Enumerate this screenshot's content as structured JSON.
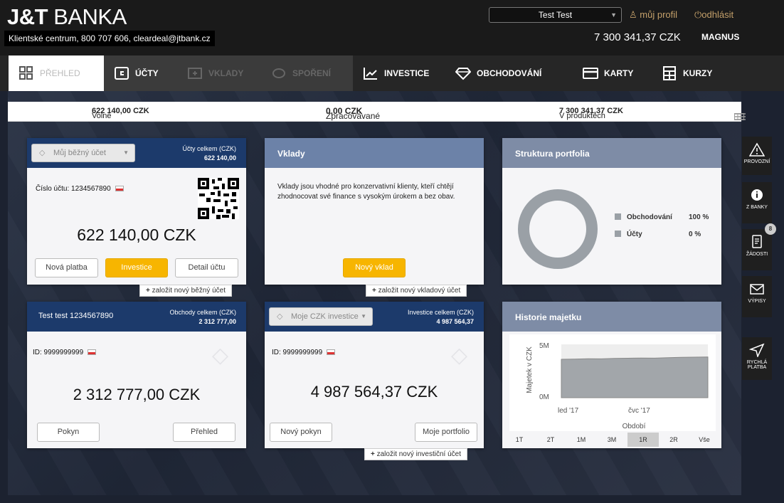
{
  "header": {
    "logo_bold": "J&T",
    "logo_rest": " BANKA",
    "contact": "Klientské centrum, 800 707 606, cleardeal@jtbank.cz",
    "profile_name": "Test Test",
    "my_profile": "můj profil",
    "logout": "odhlásit",
    "total_balance": "7 300 341,37 CZK",
    "segment": "MAGNUS"
  },
  "nav": {
    "items": [
      {
        "label": "PŘEHLED",
        "icon": "grid-icon"
      },
      {
        "label": "ÚČTY",
        "icon": "wallet-icon"
      },
      {
        "label": "VKLADY",
        "icon": "deposit-icon"
      },
      {
        "label": "SPOŘENÍ",
        "icon": "piggy-icon"
      },
      {
        "label": "INVESTICE",
        "icon": "trend-chart-icon"
      },
      {
        "label": "OBCHODOVÁNÍ",
        "icon": "diamond-icon"
      },
      {
        "label": "KARTY",
        "icon": "card-icon"
      },
      {
        "label": "KURZY",
        "icon": "calculator-icon"
      }
    ]
  },
  "summary": {
    "free_label": "Volné ",
    "free_value": "622 140,00 CZK",
    "processing_label": "Zpracovávané ",
    "processing_value": "0,00 CZK",
    "products_label": "V produktech ",
    "products_value": "7 300 341,37 CZK"
  },
  "account_card": {
    "select_value": "Můj běžný účet",
    "total_label": "Účty celkem (CZK)",
    "total_value": "622 140,00",
    "account_line": "Číslo účtu: 1234567890",
    "amount": "622 140,00 CZK",
    "btn_payment": "Nová platba",
    "btn_invest": "Investice",
    "btn_detail": "Detail účtu",
    "new_link": "založit nový běžný účet"
  },
  "deposits_card": {
    "title": "Vklady",
    "text": "Vklady jsou vhodné pro konzervativní klienty, kteří chtějí zhodnocovat své finance s vysokým úrokem a bez obav.",
    "btn_new": "Nový vklad",
    "new_link": "založit nový vkladový účet"
  },
  "portfolio_card": {
    "title": "Struktura portfolia",
    "legend": [
      {
        "label": "Obchodování",
        "value": "100 %"
      },
      {
        "label": "Účty",
        "value": "0 %"
      }
    ],
    "color": "#9aa0a6"
  },
  "trading_card": {
    "title": "Test test 1234567890",
    "total_label": "Obchody celkem (CZK)",
    "total_value": "2 312 777,00",
    "id_line": "ID: 9999999999",
    "amount": "2 312 777,00 CZK",
    "btn_order": "Pokyn",
    "btn_overview": "Přehled"
  },
  "investment_card": {
    "select_value": "Moje CZK investice",
    "total_label": "Investice celkem (CZK)",
    "total_value": "4 987 564,37",
    "id_line": "ID: 9999999999",
    "amount": "4 987 564,37 CZK",
    "btn_order": "Nový pokyn",
    "btn_portfolio": "Moje portfolio",
    "new_link": "založit nový investiční účet"
  },
  "history_card": {
    "title": "Historie majetku",
    "periods": [
      "1T",
      "2T",
      "1M",
      "3M",
      "1R",
      "2R",
      "Vše"
    ],
    "active_period": "1R"
  },
  "chart_data": {
    "type": "area",
    "ylabel": "Majetek v CZK",
    "xlabel": "Období",
    "yticks": [
      "5M",
      "0M"
    ],
    "xticks": [
      "led '17",
      "čvc '17"
    ],
    "ylim": [
      0,
      5000000
    ],
    "x": [
      0,
      1,
      2,
      3,
      4,
      5,
      6,
      7,
      8,
      9,
      10,
      11
    ],
    "values": [
      3600000,
      3620000,
      3650000,
      3640000,
      3680000,
      3700000,
      3720000,
      3710000,
      3750000,
      3780000,
      3800000,
      3820000
    ]
  },
  "sidebar": {
    "items": [
      {
        "label": "PROVOZNÍ",
        "icon": "warning-icon"
      },
      {
        "label": "Z BANKY",
        "icon": "info-icon"
      },
      {
        "label": "ŽÁDOSTI",
        "icon": "document-icon",
        "badge": "8"
      },
      {
        "label": "VÝPISY",
        "icon": "mail-icon"
      },
      {
        "label": "RYCHLÁ PLATBA",
        "icon": "send-icon"
      }
    ]
  }
}
